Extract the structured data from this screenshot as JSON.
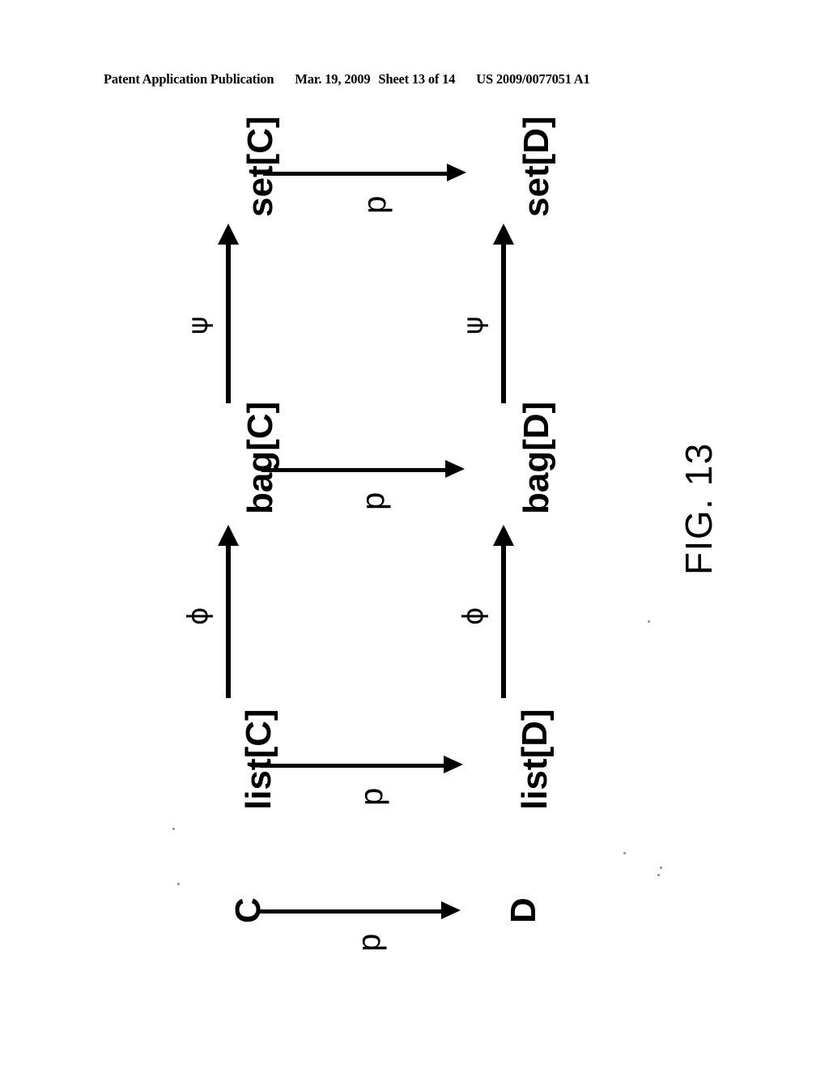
{
  "document": {
    "header": {
      "publication_label": "Patent Application Publication",
      "date": "Mar. 19, 2009",
      "sheet": "Sheet 13 of 14",
      "publication_number": "US 2009/0077051 A1"
    },
    "figure_caption": "FIG. 13",
    "ink_color": "#000000",
    "page_color": "#ffffff"
  },
  "diagram": {
    "type": "commutative-diagram",
    "orientation": "rotated-90-ccw",
    "rows": [
      {
        "id": "set-row",
        "source": "set[C]",
        "target": "set[D]",
        "arrow_label": "p"
      },
      {
        "id": "bag-row",
        "source": "bag[C]",
        "target": "bag[D]",
        "arrow_label": "p"
      },
      {
        "id": "list-row",
        "source": "list[C]",
        "target": "list[D]",
        "arrow_label": "p"
      },
      {
        "id": "base-row",
        "source": "C",
        "target": "D",
        "arrow_label": "p"
      }
    ],
    "vertical_morphisms": [
      {
        "id": "psi-left",
        "from": "bag[C]",
        "to": "set[C]",
        "label": "ψ"
      },
      {
        "id": "psi-right",
        "from": "bag[D]",
        "to": "set[D]",
        "label": "ψ"
      },
      {
        "id": "phi-left",
        "from": "list[C]",
        "to": "bag[C]",
        "label": "ϕ"
      },
      {
        "id": "phi-right",
        "from": "list[D]",
        "to": "bag[D]",
        "label": "ϕ"
      }
    ]
  }
}
